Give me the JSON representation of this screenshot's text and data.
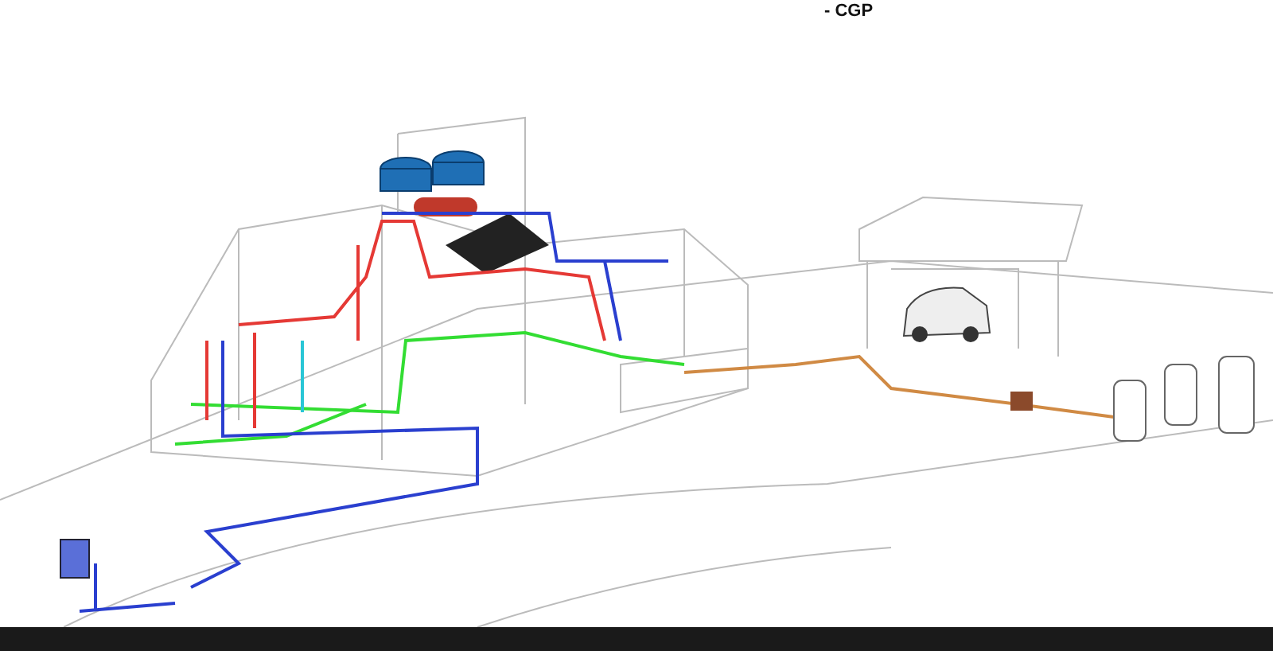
{
  "caption": {
    "text": "- CGP"
  }
}
